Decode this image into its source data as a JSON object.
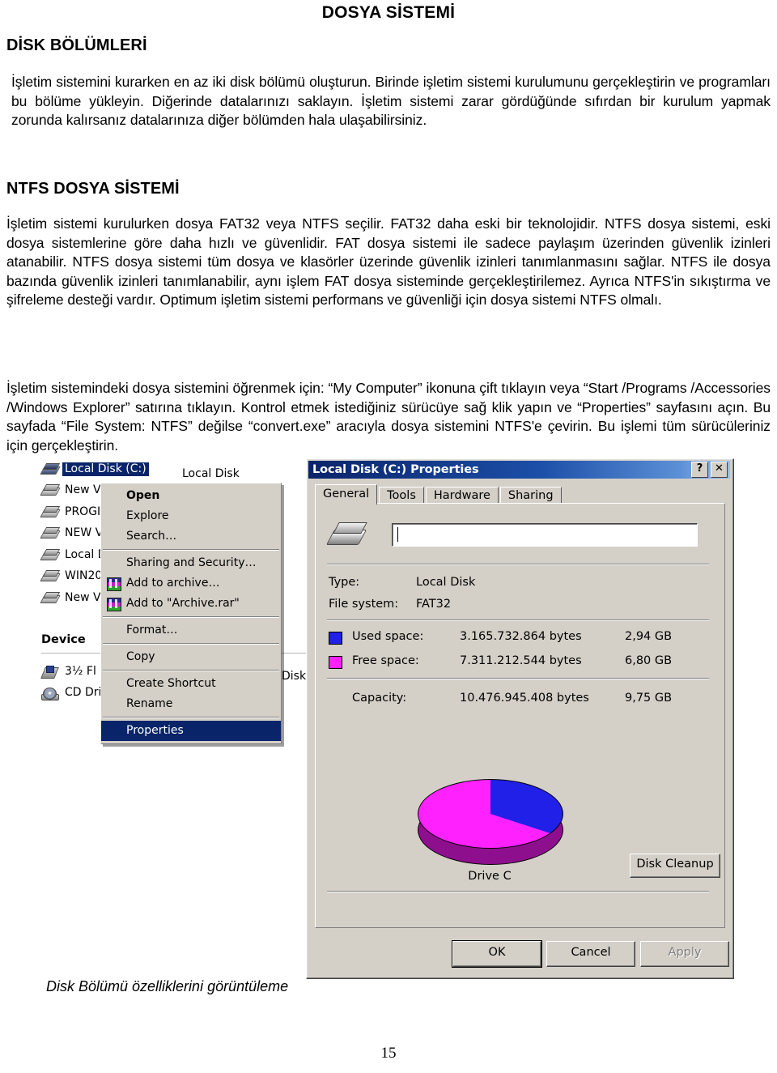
{
  "document": {
    "title": "DOSYA SİSTEMİ",
    "heading_disk": "DİSK BÖLÜMLERİ",
    "heading_ntfs": "NTFS DOSYA SİSTEMİ",
    "paragraph_1": "İşletim sistemini kurarken en az iki disk bölümü oluşturun. Birinde işletim sistemi kurulumunu gerçekleştirin ve programları bu bölüme yükleyin. Diğerinde datalarınızı saklayın. İşletim sistemi zarar gördüğünde sıfırdan bir kurulum yapmak zorunda kalırsanız datalarınıza diğer bölümden hala ulaşabilirsiniz.",
    "paragraph_2": "İşletim sistemi kurulurken dosya FAT32 veya NTFS seçilir. FAT32 daha eski bir teknolojidir. NTFS dosya sistemi, eski dosya sistemlerine göre daha hızlı ve güvenlidir. FAT dosya sistemi ile sadece paylaşım üzerinden güvenlik izinleri atanabilir. NTFS dosya sistemi tüm dosya ve klasörler üzerinde güvenlik izinleri tanımlanmasını sağlar. NTFS ile dosya bazında güvenlik izinleri tanımlanabilir, aynı işlem FAT dosya sisteminde gerçekleştirilemez. Ayrıca NTFS'in sıkıştırma ve şifreleme desteği vardır. Optimum işletim sistemi performans ve güvenliği için dosya sistemi NTFS olmalı.",
    "paragraph_3": "İşletim sistemindeki dosya sistemini öğrenmek için: “My Computer” ikonuna çift tıklayın veya “Start /Programs /Accessories /Windows Explorer” satırına tıklayın. Kontrol etmek istediğiniz sürücüye sağ klik yapın ve “Properties” sayfasını açın. Bu sayfada “File System: NTFS” değilse “convert.exe” aracıyla dosya sistemini NTFS'e çevirin. Bu işlemi tüm sürücüleriniz için gerçekleştirin.",
    "figure_caption": "Disk Bölümü özelliklerini görüntüleme",
    "page_number": "15"
  },
  "explorer": {
    "drives": [
      {
        "name": "Local Disk (C:)",
        "type": "Local Disk",
        "icon": "hard-drive-icon",
        "selected": true
      },
      {
        "name": "New V",
        "type": "",
        "icon": "hard-drive-icon",
        "selected": false
      },
      {
        "name": "PROGI",
        "type": "",
        "icon": "hard-drive-icon",
        "selected": false
      },
      {
        "name": "NEW V",
        "type": "",
        "icon": "hard-drive-icon",
        "selected": false
      },
      {
        "name": "Local D",
        "type": "",
        "icon": "hard-drive-icon",
        "selected": false
      },
      {
        "name": "WIN20",
        "type": "",
        "icon": "hard-drive-icon",
        "selected": false
      },
      {
        "name": "New V",
        "type": "",
        "icon": "hard-drive-icon",
        "selected": false
      }
    ],
    "devices_heading": "Device",
    "devices": [
      {
        "name": "3½ Fl",
        "type": "Disk",
        "icon": "floppy-drive-icon"
      },
      {
        "name": "CD Dri",
        "type": "",
        "icon": "cd-drive-icon"
      }
    ]
  },
  "context_menu": {
    "items": [
      {
        "label": "Open",
        "bold": true,
        "icon": null,
        "highlight": false,
        "separator_after": false
      },
      {
        "label": "Explore",
        "bold": false,
        "icon": null,
        "highlight": false,
        "separator_after": false
      },
      {
        "label": "Search…",
        "bold": false,
        "icon": null,
        "highlight": false,
        "separator_after": true
      },
      {
        "label": "Sharing and Security…",
        "bold": false,
        "icon": null,
        "highlight": false,
        "separator_after": false
      },
      {
        "label": "Add to archive…",
        "bold": false,
        "icon": "winrar-icon",
        "highlight": false,
        "separator_after": false
      },
      {
        "label": "Add to \"Archive.rar\"",
        "bold": false,
        "icon": "winrar-icon",
        "highlight": false,
        "separator_after": true
      },
      {
        "label": "Format…",
        "bold": false,
        "icon": null,
        "highlight": false,
        "separator_after": true
      },
      {
        "label": "Copy",
        "bold": false,
        "icon": null,
        "highlight": false,
        "separator_after": true
      },
      {
        "label": "Create Shortcut",
        "bold": false,
        "icon": null,
        "highlight": false,
        "separator_after": false
      },
      {
        "label": "Rename",
        "bold": false,
        "icon": null,
        "highlight": false,
        "separator_after": true
      },
      {
        "label": "Properties",
        "bold": false,
        "icon": null,
        "highlight": true,
        "separator_after": false
      }
    ]
  },
  "dialog": {
    "title": "Local Disk (C:) Properties",
    "help_button": "?",
    "close_button": "✕",
    "tabs": [
      {
        "label": "General",
        "active": true
      },
      {
        "label": "Tools",
        "active": false
      },
      {
        "label": "Hardware",
        "active": false
      },
      {
        "label": "Sharing",
        "active": false
      }
    ],
    "volume_label_value": "",
    "fields": [
      {
        "label": "Type:",
        "value": "Local Disk"
      },
      {
        "label": "File system:",
        "value": "FAT32"
      }
    ],
    "space": [
      {
        "label": "Used space:",
        "bytes": "3.165.732.864 bytes",
        "size": "2,94 GB",
        "color": "#2020e8"
      },
      {
        "label": "Free space:",
        "bytes": "7.311.212.544 bytes",
        "size": "6,80 GB",
        "color": "#ff22ff"
      }
    ],
    "capacity": {
      "label": "Capacity:",
      "bytes": "10.476.945.408 bytes",
      "size": "9,75 GB"
    },
    "drive_caption": "Drive C",
    "disk_cleanup_button": "Disk Cleanup",
    "buttons": [
      {
        "label": "OK",
        "disabled": false,
        "default": true
      },
      {
        "label": "Cancel",
        "disabled": false,
        "default": false
      },
      {
        "label": "Apply",
        "disabled": true,
        "default": false
      }
    ]
  },
  "chart_data": {
    "type": "pie",
    "title": "Drive C",
    "categories": [
      "Used space",
      "Free space"
    ],
    "values": [
      2.94,
      6.8
    ],
    "units": "GB",
    "percentages": [
      30.2,
      69.8
    ],
    "colors": [
      "#2020e8",
      "#ff22ff"
    ],
    "legend": "inline-with-labels"
  }
}
